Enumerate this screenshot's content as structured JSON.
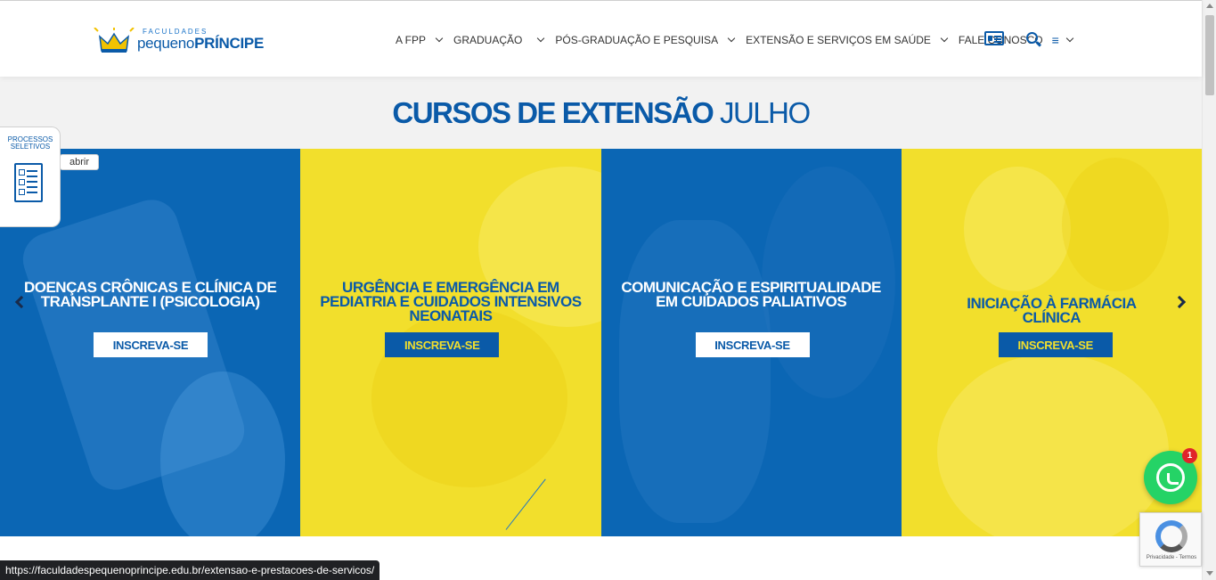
{
  "header": {
    "logo": {
      "small": "FACULDADES",
      "main_light": "pequeno",
      "main_bold": "PRÍNCIPE"
    },
    "nav": [
      {
        "label": "A FPP",
        "dropdown": true
      },
      {
        "label": "GRADUAÇÃO",
        "dropdown": true
      },
      {
        "label": "PÓS-GRADUAÇÃO E PESQUISA",
        "dropdown": true
      },
      {
        "label": "EXTENSÃO E SERVIÇOS EM SAÚDE",
        "dropdown": true
      },
      {
        "label": "FALE CONOSCO",
        "dropdown": false
      }
    ],
    "menu_icon": "≡",
    "icons": [
      "id-card-icon",
      "search-icon"
    ]
  },
  "section": {
    "title_bold": "CURSOS DE EXTENSÃO",
    "title_light": "JULHO"
  },
  "slides": [
    {
      "title": "DOENÇAS CRÔNICAS E CLÍNICA DE TRANSPLANTE I (PSICOLOGIA)",
      "button": "INSCREVA-SE",
      "theme": "blue"
    },
    {
      "title": "URGÊNCIA E EMERGÊNCIA EM PEDIATRIA E CUIDADOS INTENSIVOS NEONATAIS",
      "button": "INSCREVA-SE",
      "theme": "yellow"
    },
    {
      "title": "COMUNICAÇÃO E ESPIRITUALIDADE EM CUIDADOS PALIATIVOS",
      "button": "INSCREVA-SE",
      "theme": "blue"
    },
    {
      "title": "INICIAÇÃO À FARMÁCIA CLÍNICA",
      "button": "INSCREVA-SE",
      "theme": "yellow"
    }
  ],
  "sidebar_tab": {
    "label": "PROCESSOS SELETIVOS",
    "toggle": "abrir"
  },
  "whatsapp": {
    "badge": "1"
  },
  "recaptcha": {
    "text": "Privacidade - Termos"
  },
  "status_url": "https://faculdadespequenoprincipe.edu.br/extensao-e-prestacoes-de-servicos/",
  "colors": {
    "brand_blue": "#0a5aa8",
    "brand_yellow": "#f2df2c",
    "slide_blue": "#0b66b4",
    "whatsapp": "#25d366"
  }
}
